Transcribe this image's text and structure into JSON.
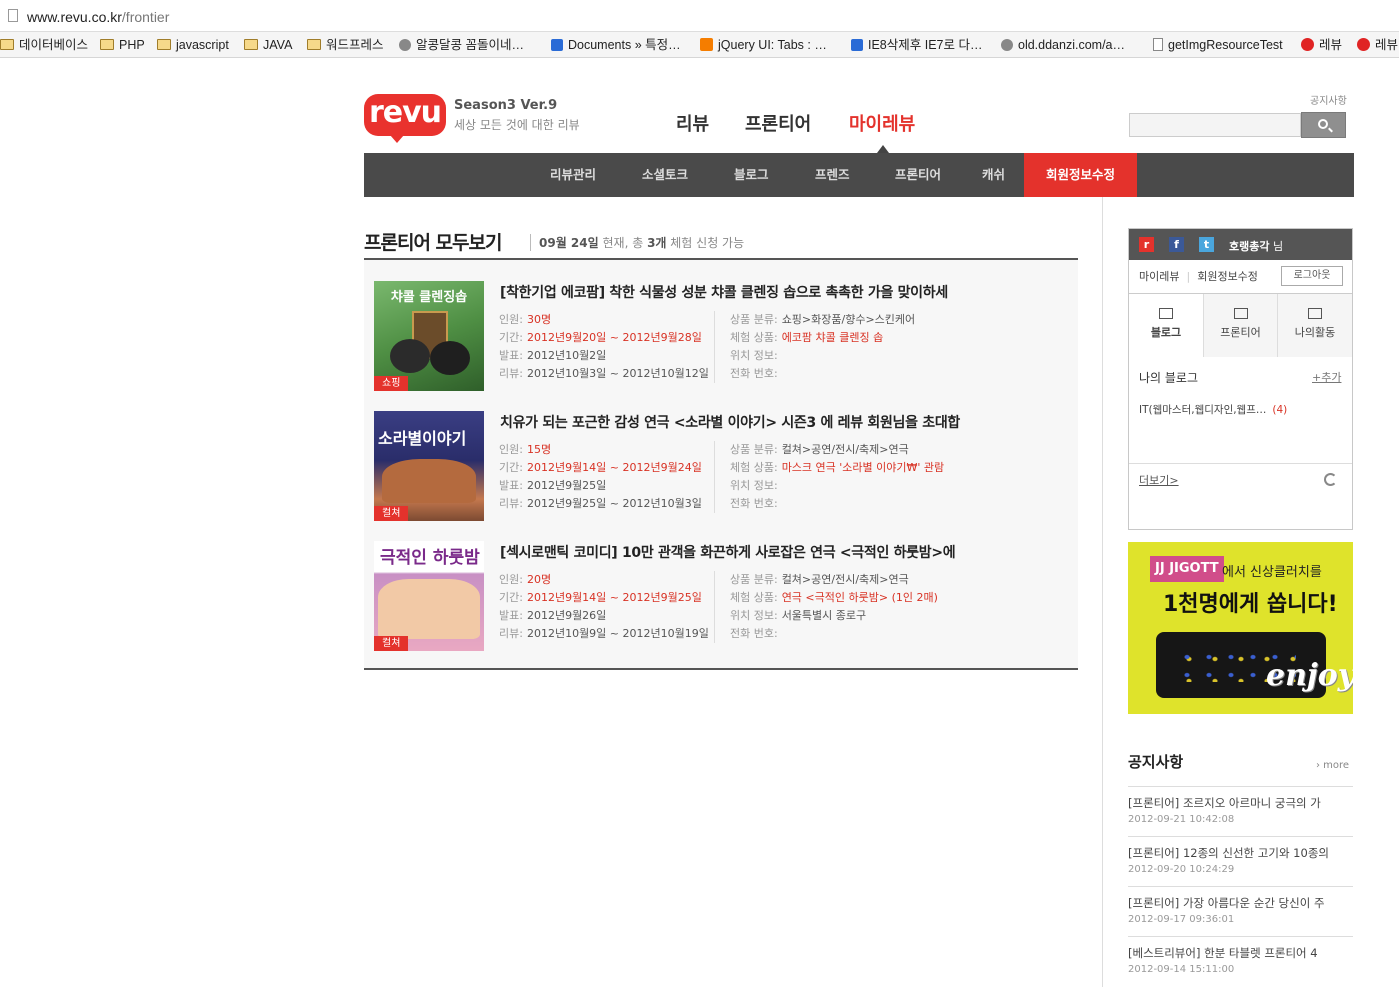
{
  "browser": {
    "url_domain": "www.revu.co.kr",
    "url_path": "/frontier",
    "bookmarks": [
      {
        "label": "데이터베이스",
        "icon": "folder-icon"
      },
      {
        "label": "PHP",
        "icon": "folder-icon"
      },
      {
        "label": "javascript",
        "icon": "folder-icon"
      },
      {
        "label": "JAVA",
        "icon": "folder-icon"
      },
      {
        "label": "워드프레스",
        "icon": "folder-icon"
      },
      {
        "label": "알콩달콩 꼼돌이네…",
        "icon": "site-icon"
      },
      {
        "label": "Documents » 특정…",
        "icon": "site-icon"
      },
      {
        "label": "jQuery UI: Tabs : …",
        "icon": "blogger-icon"
      },
      {
        "label": "IE8삭제후 IE7로 다…",
        "icon": "site-icon"
      },
      {
        "label": "old.ddanzi.com/a…",
        "icon": "site-icon"
      },
      {
        "label": "getImgResourceTest",
        "icon": "page-icon"
      },
      {
        "label": "레뷰",
        "icon": "revu-icon"
      },
      {
        "label": "레뷰",
        "icon": "revu-icon"
      }
    ]
  },
  "header": {
    "logo": "revu",
    "version": "Season3 Ver.9",
    "tagline": "세상 모든 것에 대한 리뷰",
    "nav": [
      "리뷰",
      "프론티어",
      "마이레뷰"
    ],
    "notice_link": "공지사항"
  },
  "subnav": [
    "리뷰관리",
    "소셜토크",
    "블로그",
    "프렌즈",
    "프론티어",
    "캐쉬",
    "회원정보수정"
  ],
  "content": {
    "title": "프론티어 모두보기",
    "sub_date": "09월 24일",
    "sub_mid": " 현재, 총 ",
    "sub_count": "3개",
    "sub_end": " 체험 신청 가능",
    "items": [
      {
        "category": "쇼핑",
        "thumb_text": "챠콜 클렌징솝",
        "title": "[착한기업 에코팜] 착한 식물성 성분 챠콜 클렌징 솝으로 촉촉한 가을 맞이하세",
        "people_label": "인원:",
        "people": "30명",
        "period_label": "기간:",
        "period": "2012년9월20일 ~ 2012년9월28일",
        "announce_label": "발표:",
        "announce": "2012년10월2일",
        "review_label": "리뷰:",
        "review": "2012년10월3일 ~ 2012년10월12일",
        "cat_label": "상품 분류:",
        "cat": "쇼핑>화장품/향수>스킨케어",
        "product_label": "체험 상품:",
        "product": "에코팜 챠콜 클렌징 솝",
        "loc_label": "위치 정보:",
        "loc": "",
        "phone_label": "전화 번호:",
        "phone": ""
      },
      {
        "category": "컬쳐",
        "thumb_text": "소라별이야기",
        "title": "치유가 되는 포근한 감성 연극 <소라별 이야기> 시즌3 에 레뷰 회원님을 초대합",
        "people_label": "인원:",
        "people": "15명",
        "period_label": "기간:",
        "period": "2012년9월14일 ~ 2012년9월24일",
        "announce_label": "발표:",
        "announce": "2012년9월25일",
        "review_label": "리뷰:",
        "review": "2012년9월25일 ~ 2012년10월3일",
        "cat_label": "상품 분류:",
        "cat": "컬쳐>공연/전시/축제>연극",
        "product_label": "체험 상품:",
        "product": "마스크 연극 '소라별 이야기₩' 관람",
        "loc_label": "위치 정보:",
        "loc": "",
        "phone_label": "전화 번호:",
        "phone": ""
      },
      {
        "category": "컬쳐",
        "thumb_text": "극적인 하룻밤",
        "title": "[섹시로맨틱 코미디] 10만 관객을 화끈하게 사로잡은 연극 <극적인 하룻밤>에",
        "people_label": "인원:",
        "people": "20명",
        "period_label": "기간:",
        "period": "2012년9월14일 ~ 2012년9월25일",
        "announce_label": "발표:",
        "announce": "2012년9월26일",
        "review_label": "리뷰:",
        "review": "2012년10월9일 ~ 2012년10월19일",
        "cat_label": "상품 분류:",
        "cat": "컬쳐>공연/전시/축제>연극",
        "product_label": "체험 상품:",
        "product": "연극 <극적인 하룻밤> (1인 2매)",
        "loc_label": "위치 정보:",
        "loc": "서울특별시 종로구",
        "phone_label": "전화 번호:",
        "phone": ""
      }
    ]
  },
  "sidebar": {
    "user": "호랭총각",
    "user_suffix": " 님",
    "links": [
      "마이레뷰",
      "회원정보수정"
    ],
    "logout": "로그아웃",
    "tabs": [
      "블로그",
      "프론티어",
      "나의활동"
    ],
    "my_blog": "나의 블로그",
    "add": "+추가",
    "blog_category": "IT(웹마스터,웹디자인,웹프…",
    "blog_count": "(4)",
    "more": "더보기>"
  },
  "banner": {
    "brand": "JJ JIGOTT",
    "line1": "에서 신상클러치를",
    "line2": "1천명에게 쏩니다!",
    "slogan": "enjoy"
  },
  "notices": {
    "title": "공지사항",
    "more": "› more",
    "items": [
      {
        "title": "[프론티어] 조르지오 아르마니 궁극의 가",
        "date": "2012-09-21 10:42:08"
      },
      {
        "title": "[프론티어] 12종의 신선한 고기와 10종의",
        "date": "2012-09-20 10:24:29"
      },
      {
        "title": "[프론티어] 가장 아름다운 순간 당신이 주",
        "date": "2012-09-17 09:36:01"
      },
      {
        "title": "[베스트리뷰어] 한분 타블렛 프론티어 4",
        "date": "2012-09-14 15:11:00"
      }
    ]
  },
  "colors": {
    "accent": "#e4322c",
    "subnav_bg": "#4a4a4a"
  }
}
